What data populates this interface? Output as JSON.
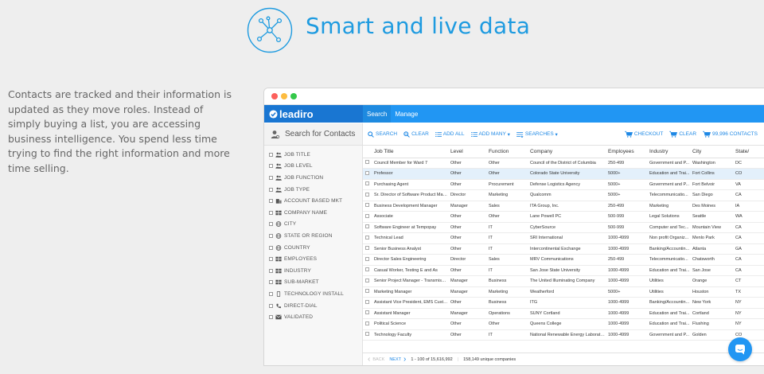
{
  "hero": {
    "title": "Smart and live data",
    "icon": "network-icon"
  },
  "description": "Contacts are tracked and their information is updated as they move roles. Instead of simply buying a list, you are accessing business intelligence. You spend less time trying to find the right information and more time selling.",
  "app": {
    "logo": "leadiro",
    "tabs": [
      "Search",
      "Manage"
    ],
    "sidebar": {
      "search_label": "Search for Contacts",
      "items": [
        {
          "label": "JOB TITLE",
          "icon": "people-icon"
        },
        {
          "label": "JOB LEVEL",
          "icon": "people-icon"
        },
        {
          "label": "JOB FUNCTION",
          "icon": "people-icon"
        },
        {
          "label": "JOB TYPE",
          "icon": "people-icon"
        },
        {
          "label": "ACCOUNT BASED MKT",
          "icon": "building-icon"
        },
        {
          "label": "COMPANY NAME",
          "icon": "grid-icon"
        },
        {
          "label": "CITY",
          "icon": "globe-icon"
        },
        {
          "label": "STATE OR REGION",
          "icon": "globe-icon"
        },
        {
          "label": "COUNTRY",
          "icon": "globe-icon"
        },
        {
          "label": "EMPLOYEES",
          "icon": "grid-icon"
        },
        {
          "label": "INDUSTRY",
          "icon": "grid-icon"
        },
        {
          "label": "SUB-MARKET",
          "icon": "grid-icon"
        },
        {
          "label": "TECHNOLOGY INSTALL",
          "icon": "device-icon"
        },
        {
          "label": "DIRECT-DIAL",
          "icon": "phone-icon"
        },
        {
          "label": "VALIDATED",
          "icon": "mail-icon"
        }
      ]
    },
    "toolbar": {
      "search": "SEARCH",
      "clear": "CLEAR",
      "add_all": "ADD ALL",
      "add_many": "ADD MANY",
      "searches": "SEARCHES",
      "checkout": "CHECKOUT",
      "clear_cart": "CLEAR",
      "contacts": "99,996 CONTACTS"
    },
    "table": {
      "columns": [
        "Job Title",
        "Level",
        "Function",
        "Company",
        "Employees",
        "Industry",
        "City",
        "State/"
      ],
      "rows": [
        [
          "Council Member for Ward 7",
          "Other",
          "Other",
          "Council of the District of Columbia",
          "250-499",
          "Government and P...",
          "Washington",
          "DC"
        ],
        [
          "Professor",
          "Other",
          "Other",
          "Colorado State University",
          "5000+",
          "Education and Trai...",
          "Fort Collins",
          "CO"
        ],
        [
          "Purchasing Agent",
          "Other",
          "Procurement",
          "Defense Logistics Agency",
          "5000+",
          "Government and P...",
          "Fort Belvoir",
          "VA"
        ],
        [
          "Sr. Director of Software Product Man...",
          "Director",
          "Marketing",
          "Qualcomm",
          "5000+",
          "Telecommunicatio...",
          "San Diego",
          "CA"
        ],
        [
          "Business Development Manager",
          "Manager",
          "Sales",
          "ITA Group, Inc.",
          "250-499",
          "Marketing",
          "Des Moines",
          "IA"
        ],
        [
          "Associate",
          "Other",
          "Other",
          "Lane Powell PC",
          "500-999",
          "Legal Solutions",
          "Seattle",
          "WA"
        ],
        [
          "Software Engineer at Tempopay",
          "Other",
          "IT",
          "CyberSource",
          "500-999",
          "Computer and Tec...",
          "Mountain View",
          "CA"
        ],
        [
          "Technical Lead",
          "Other",
          "IT",
          "SRI International",
          "1000-4999",
          "Non profit Organiz...",
          "Menlo Park",
          "CA"
        ],
        [
          "Senior Business Analyst",
          "Other",
          "IT",
          "Intercontinental Exchange",
          "1000-4999",
          "Banking/Accountin...",
          "Atlanta",
          "GA"
        ],
        [
          "Director Sales Engineering",
          "Director",
          "Sales",
          "MRV Communications",
          "250-499",
          "Telecommunicatio...",
          "Chatsworth",
          "CA"
        ],
        [
          "Casual Worker, Testing E and As",
          "Other",
          "IT",
          "San Jose State University",
          "1000-4999",
          "Education and Trai...",
          "San Jose",
          "CA"
        ],
        [
          "Senior Project Manager - Transmissio...",
          "Manager",
          "Business",
          "The United Illuminating Company",
          "1000-4999",
          "Utilities",
          "Orange",
          "CT"
        ],
        [
          "Marketing Manager",
          "Manager",
          "Marketing",
          "Weatherford",
          "5000+",
          "Utilities",
          "Houston",
          "TX"
        ],
        [
          "Assistant Vice President, EMS Custo...",
          "Other",
          "Business",
          "ITG",
          "1000-4999",
          "Banking/Accountin...",
          "New York",
          "NY"
        ],
        [
          "Assistant Manager",
          "Manager",
          "Operations",
          "SUNY Cortland",
          "1000-4999",
          "Education and Trai...",
          "Cortland",
          "NY"
        ],
        [
          "Political Science",
          "Other",
          "Other",
          "Queens College",
          "1000-4999",
          "Education and Trai...",
          "Flushing",
          "NY"
        ],
        [
          "Technology Faculty",
          "Other",
          "IT",
          "National Renewable Energy Laborato...",
          "1000-4999",
          "Government and P...",
          "Golden",
          "CO"
        ]
      ],
      "selected_row": 1
    },
    "footer": {
      "back": "BACK",
      "next": "NEXT",
      "range": "1 - 100 of 15,616,992",
      "companies": "158,149 unique companies"
    }
  },
  "colors": {
    "accent": "#1e9be0",
    "appbar": "#2196f3",
    "logo_bg": "#1976d2"
  }
}
